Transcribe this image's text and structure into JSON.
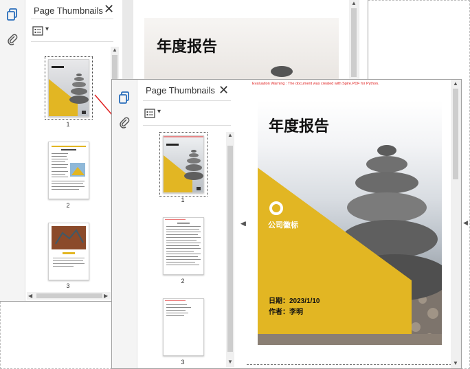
{
  "panel": {
    "title": "Page Thumbnails",
    "close": "✕",
    "options_caret": "▾"
  },
  "back_pages": [
    "1",
    "2",
    "3"
  ],
  "front_pages": [
    "1",
    "2",
    "3"
  ],
  "document": {
    "warning": "Evaluation Warning : The document was created with Spire.PDF for Python.",
    "cover_title": "年度报告",
    "logo_text": "公司徽标",
    "date_label": "日期：",
    "date_value": "2023/1/10",
    "author_label": "作者：",
    "author_value": "李明"
  },
  "colors": {
    "accent_yellow": "#e2b623",
    "arrow_red": "#e02020",
    "panel_blue": "#2a6ebb"
  },
  "icons": [
    "page-thumbnails-icon",
    "attachment-icon",
    "close-icon",
    "options-icon",
    "scroll-up-icon",
    "scroll-down-icon",
    "scroll-left-icon",
    "scroll-right-icon",
    "panel-collapse-icon"
  ]
}
